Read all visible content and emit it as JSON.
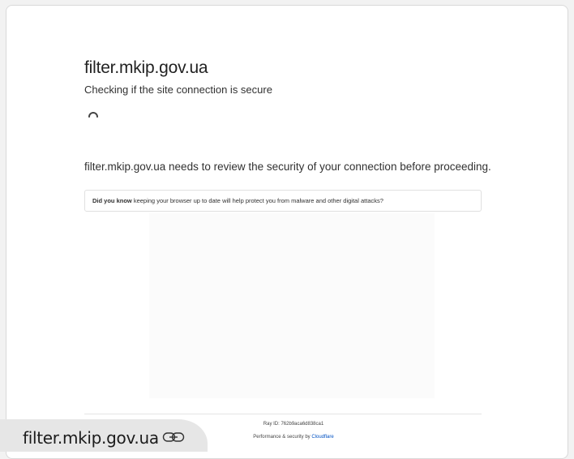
{
  "page": {
    "site_title": "filter.mkip.gov.ua",
    "checking_text": "Checking if the site connection is secure",
    "review_text": "filter.mkip.gov.ua needs to review the security of your connection before proceeding.",
    "tip": {
      "bold": "Did you know",
      "rest": " keeping your browser up to date will help protect you from malware and other digital attacks?"
    }
  },
  "footer": {
    "ray_id": "Ray ID: 762b9aca6d838ca1",
    "performance_prefix": "Performance & security by ",
    "provider": "Cloudflare"
  },
  "address_bar": {
    "url": "filter.mkip.gov.ua",
    "icon": "link-icon"
  },
  "colors": {
    "link": "#0051c3",
    "text": "#313131"
  }
}
